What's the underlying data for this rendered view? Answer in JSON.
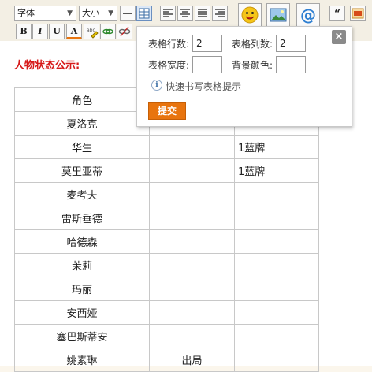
{
  "toolbar": {
    "font_select": "字体",
    "size_select": "大小",
    "bold_label": "B",
    "italic_label": "I",
    "underline_label": "U",
    "font_color_label": "A",
    "accent_color": "#e8740e"
  },
  "status_title": "人物状态公示:",
  "table_popup": {
    "rows_label": "表格行数:",
    "rows_value": "2",
    "cols_label": "表格列数:",
    "cols_value": "2",
    "width_label": "表格宽度:",
    "width_value": "",
    "bg_color_label": "背景颜色:",
    "bg_color_value": "",
    "hint_text": "快速书写表格提示",
    "submit_label": "提交",
    "close_label": "×"
  },
  "roles_table": {
    "rows": [
      [
        "角色",
        "",
        ""
      ],
      [
        "夏洛克",
        "",
        ""
      ],
      [
        "华生",
        "",
        "1蓝牌"
      ],
      [
        "莫里亚蒂",
        "",
        "1蓝牌"
      ],
      [
        "麦考夫",
        "",
        ""
      ],
      [
        "雷斯垂德",
        "",
        ""
      ],
      [
        "哈德森",
        "",
        ""
      ],
      [
        "茉莉",
        "",
        ""
      ],
      [
        "玛丽",
        "",
        ""
      ],
      [
        "安西娅",
        "",
        ""
      ],
      [
        "塞巴斯蒂安",
        "",
        ""
      ],
      [
        "姚素琳",
        "出局",
        ""
      ]
    ]
  }
}
